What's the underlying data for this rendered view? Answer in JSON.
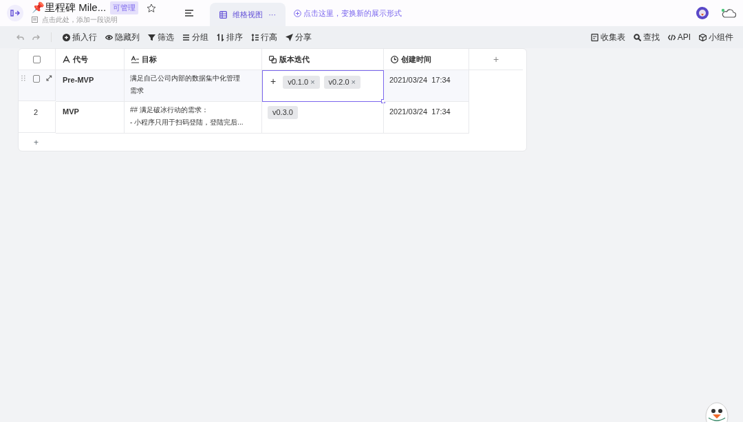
{
  "header": {
    "title": "📌里程碑 Mile...",
    "permission": "可管理",
    "description": "点击此处，添加一段说明",
    "starred": false
  },
  "views": [
    {
      "label": "维格视图",
      "more": "···",
      "selected": true
    }
  ],
  "add_view": "点击这里，变换新的展示形式",
  "toolbar_left": [
    {
      "kind": "insert",
      "label": "插入行"
    },
    {
      "kind": "eye",
      "label": "隐藏列"
    },
    {
      "kind": "filter",
      "label": "筛选"
    },
    {
      "kind": "group",
      "label": "分组"
    },
    {
      "kind": "sort",
      "label": "排序"
    },
    {
      "kind": "height",
      "label": "行高"
    },
    {
      "kind": "share",
      "label": "分享"
    }
  ],
  "toolbar_right": [
    {
      "kind": "form",
      "label": "收集表"
    },
    {
      "kind": "search",
      "label": "查找"
    },
    {
      "kind": "code",
      "label": "API"
    },
    {
      "kind": "cube",
      "label": "小组件"
    }
  ],
  "table": {
    "columns": [
      {
        "kind": "text",
        "label": "代号"
      },
      {
        "kind": "longtext",
        "label": "目标"
      },
      {
        "kind": "link",
        "label": "版本迭代"
      },
      {
        "kind": "time",
        "label": "创建时间"
      }
    ],
    "add_column": "+",
    "all_selected": false,
    "rows": [
      {
        "selected": false,
        "hovered": true,
        "code": "Pre-MVP",
        "goal": [
          "满足自己公司内部的数据集中化管理需求"
        ],
        "add_tag": "+",
        "tags": [
          "v0.1.0",
          "v0.2.0"
        ],
        "tag_remove": "×",
        "created": "2021/03/24  17:34",
        "editing": true
      },
      {
        "index": "2",
        "hovered": false,
        "code": "MVP",
        "goal": [
          "## 满足破冰行动的需求：",
          "- 小程序只用于扫码登陆，登陆完后..."
        ],
        "tags": [
          "v0.3.0"
        ],
        "created": "2021/03/24  17:34",
        "editing": false
      }
    ],
    "add_row": "+"
  }
}
